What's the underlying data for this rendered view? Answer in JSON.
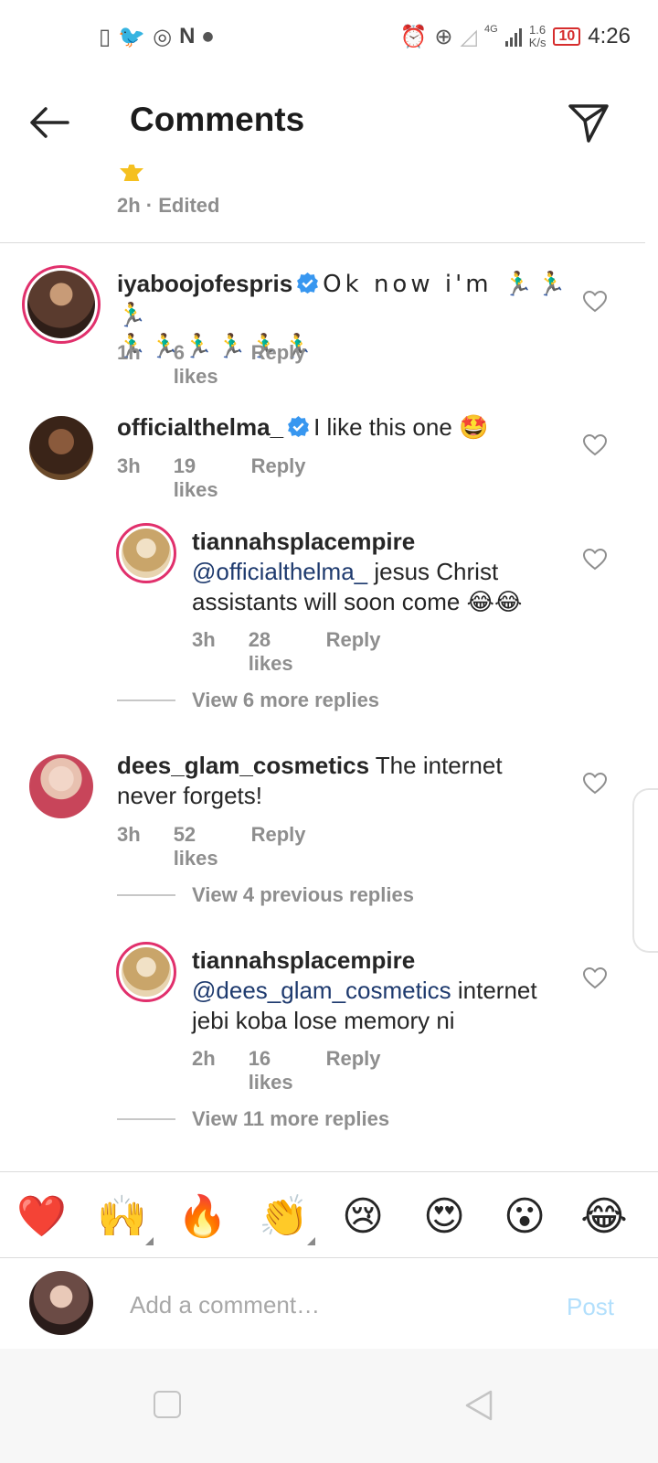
{
  "status_bar": {
    "network": "4G",
    "speed_value": "1.6",
    "speed_unit": "K/s",
    "battery": "10",
    "time": "4:26"
  },
  "header": {
    "title": "Comments"
  },
  "top_meta": "2h · Edited",
  "comments": [
    {
      "username": "iyaboojofespris",
      "verified": true,
      "text": "Ok now i'm 🏃‍♂️🏃‍♂️🏃‍♂️",
      "text_line2": "🏃‍♂️🏃‍♂️🏃‍♂️🏃‍♂️🏃‍♂️🏃‍♂️",
      "time": "1h",
      "likes": "6 likes",
      "reply": "Reply",
      "avatar_color": "#5a3b2e"
    },
    {
      "username": "officialthelma_",
      "verified": true,
      "text": "I like this one 🤩",
      "time": "3h",
      "likes": "19 likes",
      "reply": "Reply",
      "avatar_color": "#3a2418"
    },
    {
      "username": "tiannahsplacempire",
      "mention": "@officialthelma_",
      "text": " jesus Christ",
      "text_line2": "assistants will soon come 😂😂",
      "time": "3h",
      "likes": "28 likes",
      "reply": "Reply",
      "avatar_color": "#c9a56a"
    },
    {
      "username": "dees_glam_cosmetics",
      "text": " The internet",
      "text_line2": "never forgets!",
      "time": "3h",
      "likes": "52 likes",
      "reply": "Reply",
      "avatar_color": "#c8455a"
    },
    {
      "username": "tiannahsplacempire",
      "mention": "@dees_glam_cosmetics",
      "text": " internet",
      "text_line2": "jebi koba lose memory ni",
      "time": "2h",
      "likes": "16 likes",
      "reply": "Reply",
      "avatar_color": "#c9a56a"
    }
  ],
  "view_more_1": "View 6 more replies",
  "view_previous": "View 4 previous replies",
  "view_more_2": "View 11 more replies",
  "reactions": [
    "❤️",
    "🙌",
    "🔥",
    "👏",
    "😢",
    "😍",
    "😮",
    "😂"
  ],
  "composer": {
    "placeholder": "Add a comment…",
    "post": "Post"
  },
  "colors": {
    "accent_blue": "#0095f6",
    "post_disabled": "#b2dffc",
    "story_ring": "#e1306c"
  }
}
